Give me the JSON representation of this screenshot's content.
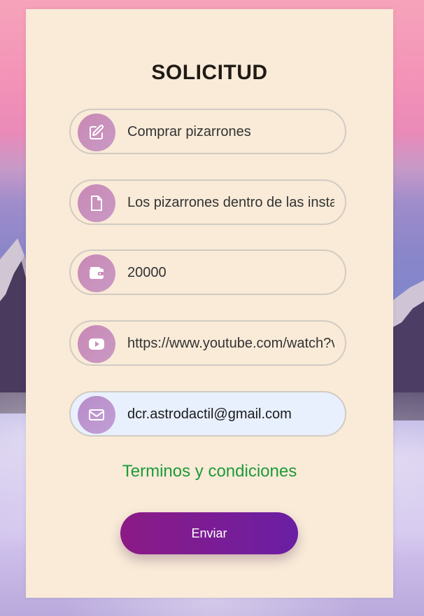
{
  "form": {
    "title": "SOLICITUD",
    "fields": [
      {
        "icon": "edit-icon",
        "value": "Comprar pizarrones"
      },
      {
        "icon": "file-icon",
        "value": "Los pizarrones dentro de las instalaciones"
      },
      {
        "icon": "wallet-icon",
        "value": "20000"
      },
      {
        "icon": "youtube-icon",
        "value": "https://www.youtube.com/watch?v="
      },
      {
        "icon": "envelope-icon",
        "value": "dcr.astrodactil@gmail.com"
      }
    ],
    "terms_link": "Terminos y condiciones",
    "submit_label": "Enviar"
  },
  "colors": {
    "card_background": "#f9ebd8",
    "icon_circle": "#c98cbb",
    "autofill_background": "#e8f0fe",
    "terms_link": "#1e9a3a",
    "button_gradient_start": "#8c1a86",
    "button_gradient_end": "#6a1fa3"
  }
}
